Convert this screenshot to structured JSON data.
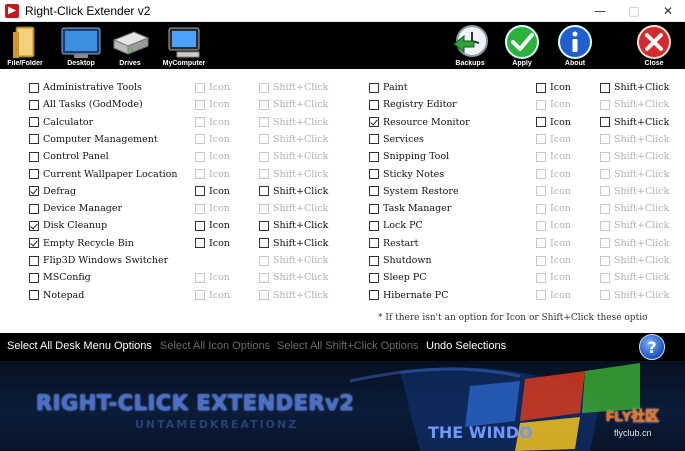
{
  "window": {
    "title": "Right-Click Extender v2",
    "controls": [
      "—",
      "□",
      "✕"
    ]
  },
  "toolbar": {
    "left": [
      {
        "label": "File/Folder",
        "icon": "folder-icon"
      },
      {
        "label": "Desktop",
        "icon": "desktop-monitor-icon"
      },
      {
        "label": "Drives",
        "icon": "drives-icon"
      },
      {
        "label": "MyComputer",
        "icon": "computer-icon"
      }
    ],
    "right": [
      {
        "label": "Backups",
        "icon": "backup-clock-icon"
      },
      {
        "label": "Apply",
        "icon": "green-check-icon"
      },
      {
        "label": "About",
        "icon": "info-icon"
      },
      {
        "label": "Close",
        "icon": "red-x-icon"
      }
    ]
  },
  "options": {
    "icon_label": "Icon",
    "shift_label": "Shift+Click",
    "left": [
      {
        "label": "Administrative Tools",
        "checked": false,
        "icon_enabled": false,
        "icon_checked": false,
        "shift_enabled": false,
        "shift_checked": false
      },
      {
        "label": "All Tasks (GodMode)",
        "checked": false,
        "icon_enabled": false,
        "icon_checked": false,
        "shift_enabled": false,
        "shift_checked": false
      },
      {
        "label": "Calculator",
        "checked": false,
        "icon_enabled": false,
        "icon_checked": false,
        "shift_enabled": false,
        "shift_checked": false
      },
      {
        "label": "Computer Management",
        "checked": false,
        "icon_enabled": false,
        "icon_checked": false,
        "shift_enabled": false,
        "shift_checked": false
      },
      {
        "label": "Control Panel",
        "checked": false,
        "icon_enabled": false,
        "icon_checked": false,
        "shift_enabled": false,
        "shift_checked": false
      },
      {
        "label": "Current Wallpaper Location",
        "checked": false,
        "icon_enabled": false,
        "icon_checked": false,
        "shift_enabled": false,
        "shift_checked": false
      },
      {
        "label": "Defrag",
        "checked": true,
        "icon_enabled": true,
        "icon_checked": false,
        "shift_enabled": true,
        "shift_checked": false
      },
      {
        "label": "Device Manager",
        "checked": false,
        "icon_enabled": false,
        "icon_checked": false,
        "shift_enabled": false,
        "shift_checked": false
      },
      {
        "label": "Disk Cleanup",
        "checked": true,
        "icon_enabled": true,
        "icon_checked": false,
        "shift_enabled": true,
        "shift_checked": false
      },
      {
        "label": "Empty Recycle Bin",
        "checked": true,
        "icon_enabled": true,
        "icon_checked": false,
        "shift_enabled": true,
        "shift_checked": false
      },
      {
        "label": "Flip3D Windows Switcher",
        "checked": false,
        "icon_enabled": false,
        "icon_checked": false,
        "shift_enabled": false,
        "shift_checked": false,
        "no_icon": true
      },
      {
        "label": "MSConfig",
        "checked": false,
        "icon_enabled": false,
        "icon_checked": false,
        "shift_enabled": false,
        "shift_checked": false
      },
      {
        "label": "Notepad",
        "checked": false,
        "icon_enabled": false,
        "icon_checked": false,
        "shift_enabled": false,
        "shift_checked": false
      }
    ],
    "right": [
      {
        "label": "Paint",
        "checked": false,
        "icon_enabled": true,
        "icon_checked": false,
        "shift_enabled": true,
        "shift_checked": false
      },
      {
        "label": "Registry Editor",
        "checked": false,
        "icon_enabled": false,
        "icon_checked": false,
        "shift_enabled": false,
        "shift_checked": false
      },
      {
        "label": "Resource Monitor",
        "checked": true,
        "icon_enabled": true,
        "icon_checked": false,
        "shift_enabled": true,
        "shift_checked": false
      },
      {
        "label": "Services",
        "checked": false,
        "icon_enabled": false,
        "icon_checked": false,
        "shift_enabled": false,
        "shift_checked": false
      },
      {
        "label": "Snipping Tool",
        "checked": false,
        "icon_enabled": false,
        "icon_checked": false,
        "shift_enabled": false,
        "shift_checked": false
      },
      {
        "label": "Sticky Notes",
        "checked": false,
        "icon_enabled": false,
        "icon_checked": false,
        "shift_enabled": false,
        "shift_checked": false
      },
      {
        "label": "System Restore",
        "checked": false,
        "icon_enabled": false,
        "icon_checked": false,
        "shift_enabled": false,
        "shift_checked": false
      },
      {
        "label": "Task Manager",
        "checked": false,
        "icon_enabled": false,
        "icon_checked": false,
        "shift_enabled": false,
        "shift_checked": false
      },
      {
        "label": "Lock PC",
        "checked": false,
        "icon_enabled": false,
        "icon_checked": false,
        "shift_enabled": false,
        "shift_checked": false
      },
      {
        "label": "Restart",
        "checked": false,
        "icon_enabled": false,
        "icon_checked": false,
        "shift_enabled": false,
        "shift_checked": false
      },
      {
        "label": "Shutdown",
        "checked": false,
        "icon_enabled": false,
        "icon_checked": false,
        "shift_enabled": false,
        "shift_checked": false
      },
      {
        "label": "Sleep PC",
        "checked": false,
        "icon_enabled": false,
        "icon_checked": false,
        "shift_enabled": false,
        "shift_checked": false
      },
      {
        "label": "Hibernate PC",
        "checked": false,
        "icon_enabled": false,
        "icon_checked": false,
        "shift_enabled": false,
        "shift_checked": false
      }
    ],
    "footnote": "* If there isn't an option for Icon or Shift+Click these optio"
  },
  "bottom": {
    "select_all_desk": "Select All Desk Menu Options",
    "select_all_icon": "Select All Icon Options",
    "select_all_shift": "Select All Shift+Click Options",
    "undo": "Undo Selections",
    "help": "?"
  },
  "banner": {
    "title": "RIGHT-CLICK EXTENDERv2",
    "subtitle": "UNTAMEDKREATIONZ",
    "club": "THE WINDO",
    "watermark": "FLY社区",
    "watermark_url": "flyclub.cn"
  }
}
